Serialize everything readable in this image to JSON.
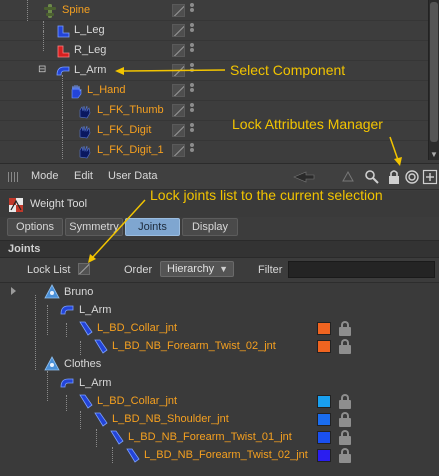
{
  "object_manager": {
    "rows": [
      {
        "label": "Spine",
        "color": "orange",
        "icon": "spine-figure-icon"
      },
      {
        "label": "L_Leg",
        "color": "white",
        "icon": "leg-component-icon"
      },
      {
        "label": "R_Leg",
        "color": "white",
        "icon": "leg-component-icon"
      },
      {
        "label": "L_Arm",
        "color": "white",
        "icon": "arm-component-icon"
      },
      {
        "label": "L_Hand",
        "color": "orange",
        "icon": "hand-component-icon"
      },
      {
        "label": "L_FK_Thumb",
        "color": "orange",
        "icon": "finger-component-icon"
      },
      {
        "label": "L_FK_Digit",
        "color": "orange",
        "icon": "finger-component-icon"
      },
      {
        "label": "L_FK_Digit_1",
        "color": "orange",
        "icon": "finger-component-icon"
      }
    ]
  },
  "annotations": {
    "select_component": "Select Component",
    "lock_attributes_manager": "Lock Attributes Manager",
    "lock_joints_list": "Lock joints list to the current selection"
  },
  "attribute_manager": {
    "menu": {
      "mode": "Mode",
      "edit": "Edit",
      "user_data": "User Data"
    },
    "title": "Weight Tool",
    "tabs": [
      "Options",
      "Symmetry",
      "Joints",
      "Display"
    ],
    "active_tab": "Joints",
    "section_label": "Joints",
    "lock_list_label": "Lock List",
    "order_label": "Order",
    "order_value": "Hierarchy",
    "filter_label": "Filter",
    "filter_value": ""
  },
  "joints": [
    {
      "label": "Bruno",
      "color": "white",
      "icon": "figure-icon"
    },
    {
      "label": "L_Arm",
      "color": "white",
      "icon": "arm-component-icon"
    },
    {
      "label": "L_BD_Collar_jnt",
      "color": "orange",
      "icon": "joint-icon",
      "swatch": "#f06420"
    },
    {
      "label": "L_BD_NB_Forearm_Twist_02_jnt",
      "color": "orange",
      "icon": "joint-icon",
      "swatch": "#f06420"
    },
    {
      "label": "Clothes",
      "color": "white",
      "icon": "figure-icon"
    },
    {
      "label": "L_Arm",
      "color": "white",
      "icon": "arm-component-icon"
    },
    {
      "label": "L_BD_Collar_jnt",
      "color": "orange",
      "icon": "joint-icon",
      "swatch": "#19a0f0"
    },
    {
      "label": "L_BD_NB_Shoulder_jnt",
      "color": "orange",
      "icon": "joint-icon",
      "swatch": "#1a6df0"
    },
    {
      "label": "L_BD_NB_Forearm_Twist_01_jnt",
      "color": "orange",
      "icon": "joint-icon",
      "swatch": "#1a50f0"
    },
    {
      "label": "L_BD_NB_Forearm_Twist_02_jnt",
      "color": "orange",
      "icon": "joint-icon",
      "swatch": "#2a1ef0"
    }
  ],
  "colors": {
    "orange_text": "#f5a020",
    "annotation": "#f2c400",
    "active_tab": "#7fa6d0"
  }
}
